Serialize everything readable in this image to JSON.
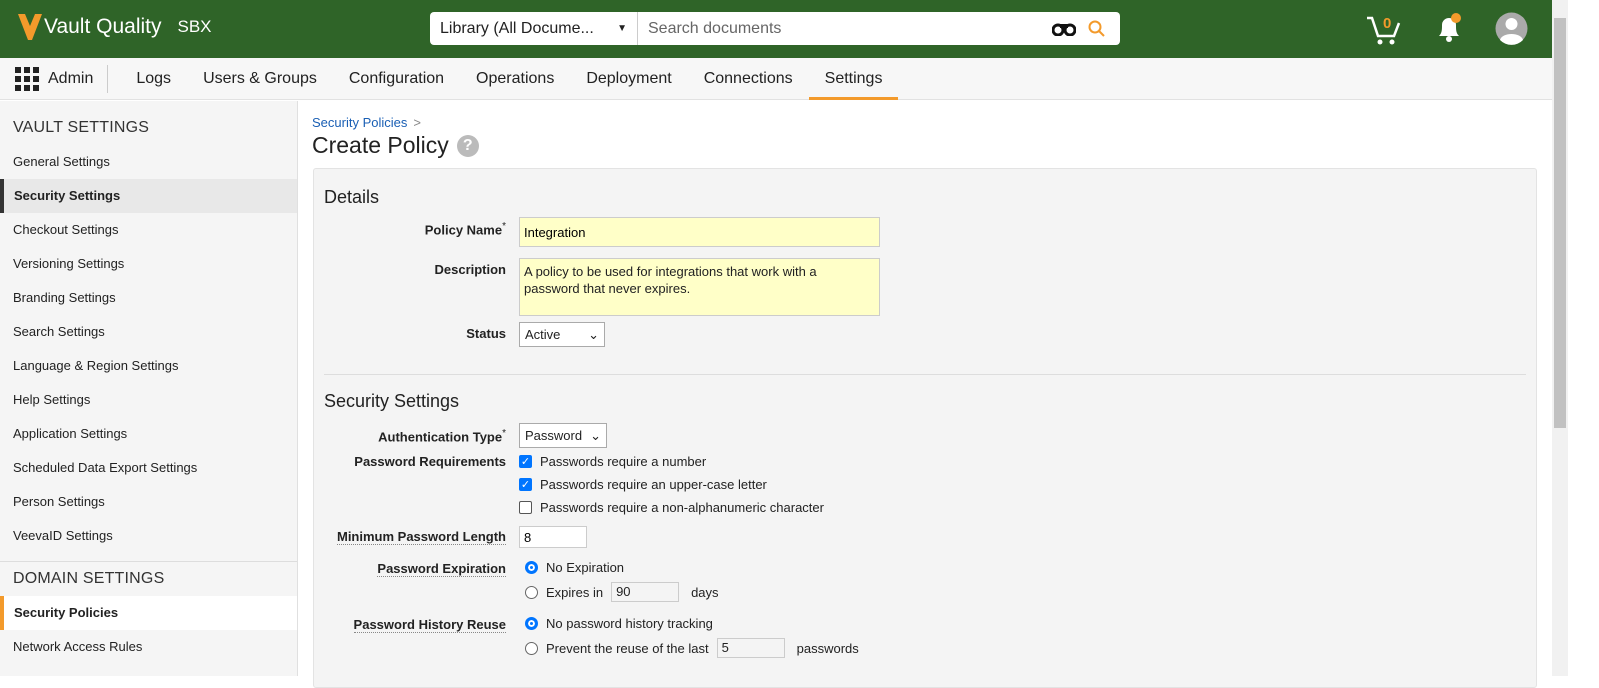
{
  "header": {
    "app_name": "Vault Quality",
    "env": "SBX",
    "library_select": "Library (All Docume...",
    "search_placeholder": "Search documents",
    "cart_count": "0",
    "colors": {
      "brand": "#2f6428",
      "accent": "#f39a2b"
    }
  },
  "nav": {
    "apps_label": "Admin",
    "tabs": [
      {
        "label": "Logs"
      },
      {
        "label": "Users & Groups"
      },
      {
        "label": "Configuration"
      },
      {
        "label": "Operations"
      },
      {
        "label": "Deployment"
      },
      {
        "label": "Connections"
      },
      {
        "label": "Settings"
      }
    ]
  },
  "sidebar": {
    "vault_heading": "VAULT SETTINGS",
    "vault_items": [
      "General Settings",
      "Security Settings",
      "Checkout Settings",
      "Versioning Settings",
      "Branding Settings",
      "Search Settings",
      "Language & Region Settings",
      "Help Settings",
      "Application Settings",
      "Scheduled Data Export Settings",
      "Person Settings",
      "VeevaID Settings"
    ],
    "domain_heading": "DOMAIN SETTINGS",
    "domain_items": [
      "Security Policies",
      "Network Access Rules"
    ]
  },
  "page": {
    "breadcrumb": "Security Policies",
    "breadcrumb_sep": ">",
    "title": "Create Policy",
    "help": "?"
  },
  "details": {
    "heading": "Details",
    "policy_name_label": "Policy Name",
    "required": "*",
    "policy_name": "Integration",
    "description_label": "Description",
    "description": "A policy to be used for integrations that work with a password that never expires.",
    "status_label": "Status",
    "status": "Active"
  },
  "security": {
    "heading": "Security Settings",
    "auth_label": "Authentication Type",
    "auth_value": "Password",
    "req_label": "Password Requirements",
    "requirements": [
      {
        "label": "Passwords require a number",
        "checked": true
      },
      {
        "label": "Passwords require an upper-case letter",
        "checked": true
      },
      {
        "label": "Passwords require a non-alphanumeric character",
        "checked": false
      }
    ],
    "min_len_label": "Minimum Password Length",
    "min_len": "8",
    "exp_label": "Password Expiration",
    "exp_none": "No Expiration",
    "exp_in": "Expires in",
    "exp_days": "90",
    "days": "days",
    "hist_label": "Password History Reuse",
    "hist_none": "No password history tracking",
    "hist_prevent": "Prevent the reuse of the last",
    "hist_count": "5",
    "passwords": "passwords"
  }
}
